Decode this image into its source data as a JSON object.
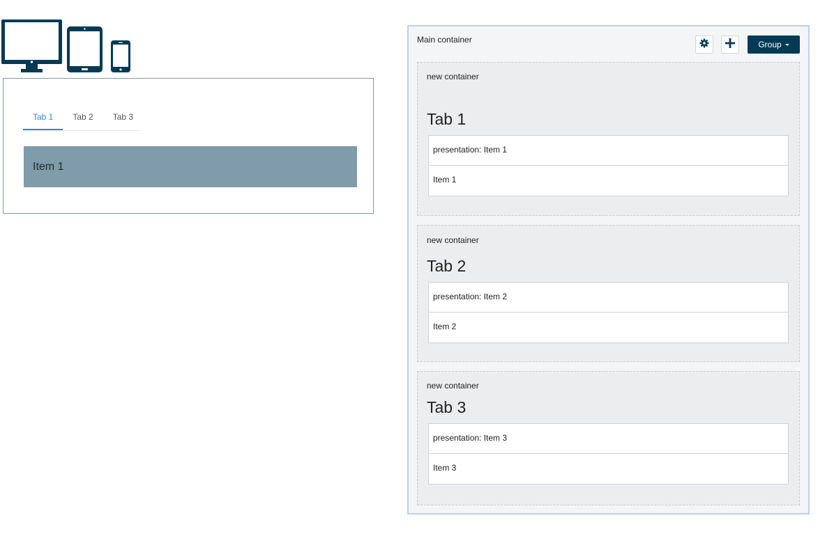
{
  "devices": [
    {
      "name": "desktop-icon"
    },
    {
      "name": "tablet-icon"
    },
    {
      "name": "phone-icon"
    }
  ],
  "preview": {
    "tabs": [
      "Tab 1",
      "Tab 2",
      "Tab 3"
    ],
    "active_tab": "Tab 1",
    "panel_text": "Item 1",
    "colors": {
      "accent": "#2c8bd6",
      "panel": "#809ba9"
    }
  },
  "editor": {
    "title": "Main container",
    "settings_icon": "gear-icon",
    "add_icon": "plus-icon",
    "group_label": "Group",
    "containers": [
      {
        "label": "new container",
        "tab_title": "Tab 1",
        "presentation": "presentation: Item 1",
        "item": "Item 1"
      },
      {
        "label": "new container",
        "tab_title": "Tab 2",
        "presentation": "presentation: Item 2",
        "item": "Item 2"
      },
      {
        "label": "new container",
        "tab_title": "Tab 3",
        "presentation": "presentation: Item 3",
        "item": "Item 3"
      }
    ],
    "colors": {
      "primary": "#053a55",
      "selection_border": "#bcd0ef"
    }
  }
}
